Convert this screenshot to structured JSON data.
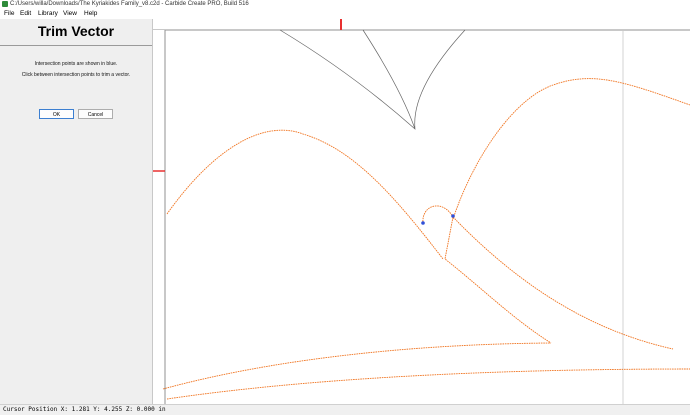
{
  "window": {
    "title": "C:/Users/willa/Downloads/The Kyriakides Family_v8.c2d - Carbide Create PRO, Build 516"
  },
  "menu": {
    "items": [
      "File",
      "Edit",
      "Library",
      "View",
      "Help"
    ]
  },
  "panel": {
    "title": "Trim Vector",
    "line1": "Intersection points are shown in blue.",
    "line2": "Click between intersection points to trim a vector.",
    "ok_label": "OK",
    "cancel_label": "Cancel"
  },
  "status": {
    "text": "Cursor Position X: 1.281 Y: 4.255 Z: 0.000 in"
  },
  "colors": {
    "vector": "#f07420",
    "unselected_vector": "#666666",
    "intersection": "#3050d8",
    "ruler_marker": "#e83030",
    "app_icon": "#2e8b3a"
  }
}
